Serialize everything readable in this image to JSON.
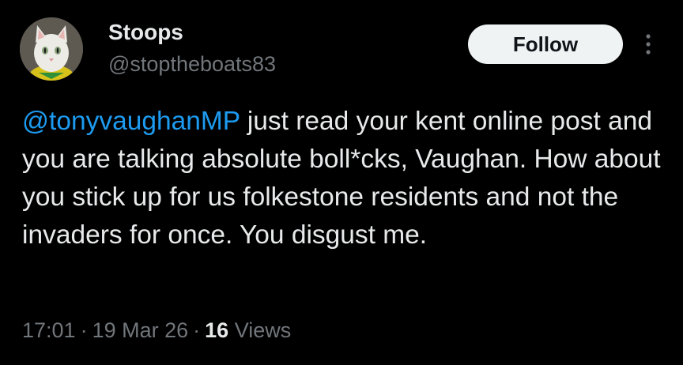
{
  "user": {
    "display_name": "Stoops",
    "handle": "@stoptheboats83"
  },
  "actions": {
    "follow_label": "Follow",
    "more_icon": "more-vertical-icon"
  },
  "tweet": {
    "mention": "@tonyvaughanMP",
    "body": " just read your kent online post and you are talking absolute boll*cks, Vaughan. How about you stick up for us folkestone residents and not the invaders for once. You disgust me."
  },
  "meta": {
    "time": "17:01",
    "separator": "·",
    "date": "19 Mar 26",
    "views_count": "16",
    "views_label": "Views"
  },
  "colors": {
    "background": "#000000",
    "text": "#e7e9ea",
    "secondary": "#71767b",
    "link": "#1d9bf0",
    "follow_bg": "#eff3f4"
  }
}
